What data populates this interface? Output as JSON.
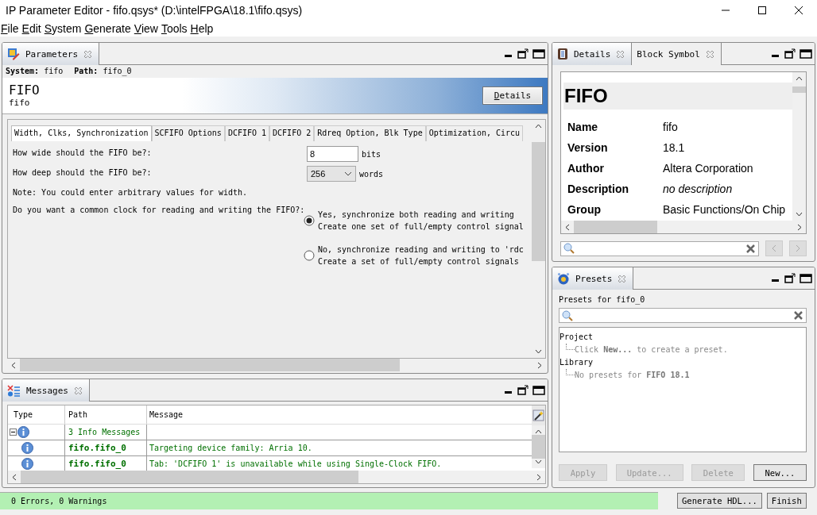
{
  "window": {
    "title": "IP Parameter Editor - fifo.qsys* (D:\\intelFPGA\\18.1\\fifo.qsys)"
  },
  "menu": [
    "File",
    "Edit",
    "System",
    "Generate",
    "View",
    "Tools",
    "Help"
  ],
  "parameters_panel": {
    "tab": "Parameters",
    "system_label": "System:",
    "system": "fifo",
    "path_label": "Path:",
    "path": "fifo_0",
    "component_title": "FIFO",
    "component_name": "fifo",
    "details_button": "Details",
    "tabs": [
      {
        "label": "Width, Clks, Synchronization",
        "selected": true
      },
      {
        "label": "SCFIFO Options",
        "selected": false
      },
      {
        "label": "DCFIFO 1",
        "selected": false
      },
      {
        "label": "DCFIFO 2",
        "selected": false
      },
      {
        "label": "Rdreq Option, Blk Type",
        "selected": false
      },
      {
        "label": "Optimization, Circu",
        "selected": false
      }
    ],
    "fields": [
      {
        "kind": "text",
        "label": "How wide should the FIFO be?:",
        "value": "8",
        "unit": "bits"
      },
      {
        "kind": "dropdown",
        "label": "How deep should the FIFO be?:",
        "value": "256",
        "unit": "words"
      },
      {
        "kind": "note",
        "label": "Note: You could enter arbitrary values for width."
      },
      {
        "kind": "radio",
        "label": "Do you want a common clock for reading and writing the FIFO?:",
        "options": [
          {
            "lines": [
              "Yes, synchronize both reading and writing",
              "Create one set of full/empty control signal"
            ],
            "selected": true
          },
          {
            "lines": [
              "No, synchronize reading and writing to 'rdc",
              "Create a set of full/empty control signals"
            ],
            "selected": false
          }
        ]
      }
    ]
  },
  "messages_panel": {
    "tab": "Messages",
    "columns": [
      "Type",
      "Path",
      "Message"
    ],
    "groups": [
      {
        "label": "3 Info Messages",
        "expanded": true,
        "rows": [
          {
            "path": "fifo.fifo_0",
            "message": "Targeting device family: Arria 10."
          },
          {
            "path": "fifo.fifo_0",
            "message": "Tab: 'DCFIFO 1' is unavailable while using Single-Clock FIFO."
          }
        ]
      }
    ]
  },
  "status_bar": {
    "text": "0 Errors, 0 Warnings"
  },
  "footer_buttons": [
    "Generate HDL...",
    "Finish"
  ],
  "details_panel": {
    "tabs": [
      {
        "label": "Details",
        "selected": true
      },
      {
        "label": "Block Symbol",
        "selected": false
      }
    ],
    "title": "FIFO",
    "properties": [
      {
        "name": "Name",
        "value": "fifo",
        "kind": "plain"
      },
      {
        "name": "Version",
        "value": "18.1",
        "kind": "plain"
      },
      {
        "name": "Author",
        "value": "Altera Corporation",
        "kind": "plain"
      },
      {
        "name": "Description",
        "value": "no description",
        "kind": "empty"
      },
      {
        "name": "Group",
        "value": "Basic Functions/On Chip",
        "kind": "plain"
      }
    ]
  },
  "presets_panel": {
    "tab": "Presets",
    "heading": "Presets for fifo_0",
    "tree": [
      {
        "label": "Project",
        "children": [
          {
            "label": "Click **New...** to create a preset."
          }
        ]
      },
      {
        "label": "Library",
        "children": [
          {
            "label": "No presets for **FIFO 18.1**"
          }
        ]
      }
    ],
    "buttons": [
      {
        "label": "Apply",
        "disabled": true
      },
      {
        "label": "Update...",
        "disabled": true
      },
      {
        "label": "Delete",
        "disabled": true
      },
      {
        "label": "New...",
        "disabled": false
      }
    ]
  }
}
